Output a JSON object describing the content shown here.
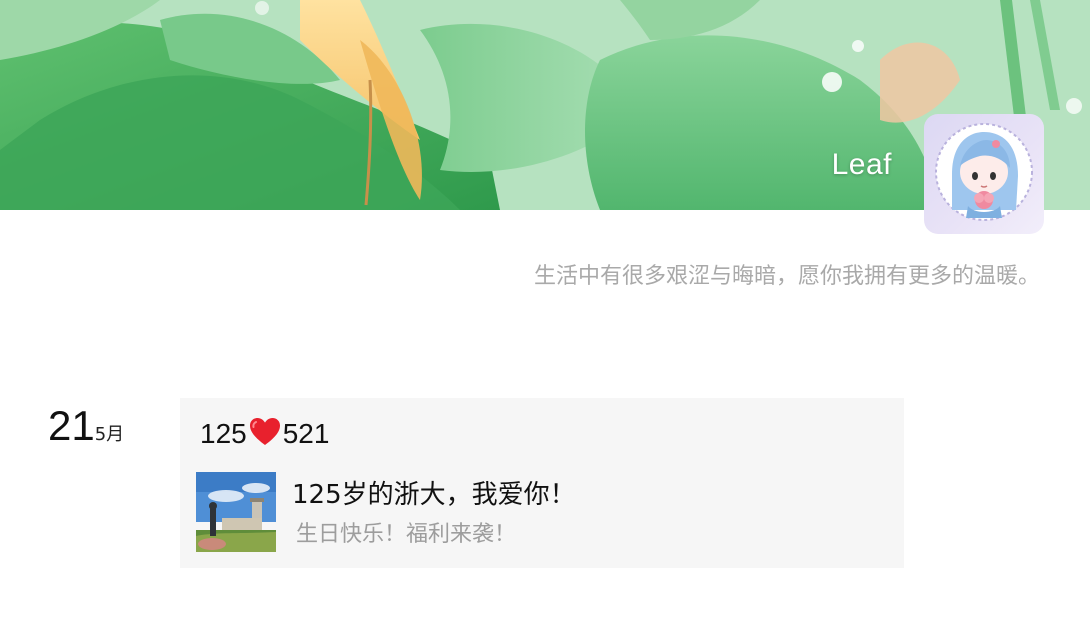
{
  "profile": {
    "owner_name": "Leaf",
    "signature": "生活中有很多艰涩与晦暗，愿你我拥有更多的温暖。"
  },
  "posts": [
    {
      "date_day": "21",
      "date_month": "5月",
      "title_prefix": "125",
      "title_icon": "red-heart-icon",
      "title_suffix": "521",
      "link": {
        "title": "125岁的浙大，我爱你！",
        "description": "生日快乐！福利来袭！"
      }
    }
  ],
  "colors": {
    "card_background": "#f6f6f6",
    "signature_text": "#a9a9a9",
    "link_description": "#9d9d9d",
    "banner_green": "#8fd0a1"
  }
}
